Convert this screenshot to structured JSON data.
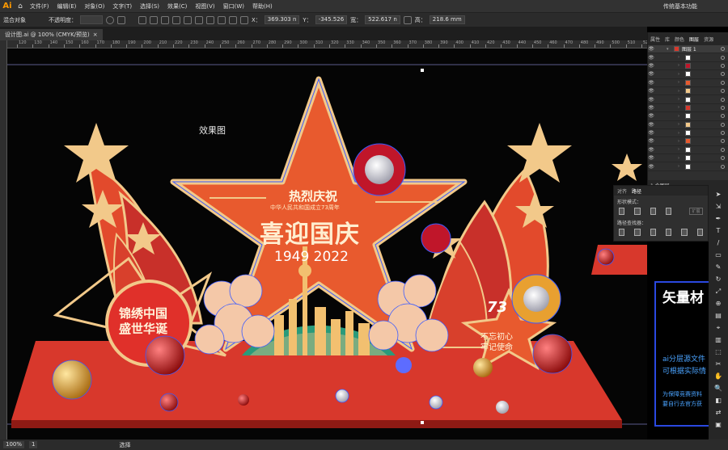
{
  "app": {
    "logo": "Ai",
    "workspace": "传统基本功能"
  },
  "menu": [
    "文件(F)",
    "编辑(E)",
    "对象(O)",
    "文字(T)",
    "选择(S)",
    "效果(C)",
    "视图(V)",
    "窗口(W)",
    "帮助(H)"
  ],
  "control": {
    "selection_label": "混合对象",
    "opacity_label": "不透明度：",
    "x_label": "X：",
    "x_value": "369.303 n",
    "y_label": "Y：",
    "y_value": "-345.526",
    "w_label": "宽：",
    "w_value": "522.617 n",
    "h_label": "高：",
    "h_value": "218.6 mm"
  },
  "document_tab": {
    "title": "设计图.ai @ 100% (CMYK/预览)",
    "close": "×"
  },
  "ruler": {
    "labels": [
      "120",
      "130",
      "140",
      "150",
      "160",
      "170",
      "180",
      "190",
      "200",
      "210",
      "220",
      "230",
      "240",
      "250",
      "260",
      "270",
      "280",
      "290",
      "300",
      "310",
      "320",
      "330",
      "340",
      "350",
      "360",
      "370",
      "380",
      "390",
      "400",
      "410",
      "420",
      "430",
      "440",
      "450",
      "460",
      "470",
      "480",
      "490",
      "500",
      "510",
      "520"
    ]
  },
  "status": {
    "zoom": "100%",
    "page": "1",
    "tool": "选择"
  },
  "layers_panel": {
    "tabs": [
      "属性",
      "库",
      "颜色",
      "图层",
      "资源"
    ],
    "active_tab": "图层",
    "top_layer": "图层 1",
    "row_count": 15,
    "footer": "1 个图层"
  },
  "pathfinder_panel": {
    "tabs": [
      "对齐",
      "路径"
    ],
    "shape_modes_label": "形状模式：",
    "apply_label": "扩展",
    "pathfinders_label": "路径查找器："
  },
  "artwork": {
    "label": "效果图",
    "headline": "热烈庆祝",
    "subline": "中华人民共和国成立73周年",
    "title": "喜迎国庆",
    "years": "1949 2022",
    "slogan_left_1": "锦绣中国",
    "slogan_left_2": "盛世华诞",
    "slogan_right_1": "不忘初心",
    "slogan_right_2": "牢记使命",
    "badge": "73"
  },
  "side_card": {
    "title": "矢量材",
    "line1": "ai分层源文件",
    "line2": "可根据实际情",
    "line3": "为保障竞赛资料",
    "line4": "要自行去官方获"
  },
  "colors": {
    "red": "#e03a2b",
    "star_fill": "#e85a2e",
    "gold": "#f2c98a",
    "selection_blue": "#3b5bff",
    "text_blue": "#4aa3ff"
  }
}
